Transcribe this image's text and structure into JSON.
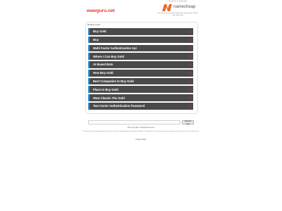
{
  "site": {
    "name": "wawguru.net"
  },
  "sponsor": {
    "note": "This domain is registered at",
    "logo_text": "namecheap",
    "description": "This domain was recently registered at Namecheap. Please check back later!"
  },
  "colors": {
    "accent": "#e8352e",
    "logo_orange": "#f26522",
    "item_bg": "#4a4a4a",
    "item_bar": "#2f8fd1"
  },
  "related": {
    "title": "Related Links",
    "links": [
      {
        "label": "Buy Gold"
      },
      {
        "label": "Buy"
      },
      {
        "label": "Multi Factor Authentication Api"
      },
      {
        "label": "Where I Can Buy Gold"
      },
      {
        "label": "AI Based Bots"
      },
      {
        "label": "How Buy Gold"
      },
      {
        "label": "Best Companies to Buy Gold"
      },
      {
        "label": "Place to Buy Gold"
      },
      {
        "label": "Wow Classic Tbc Gold"
      },
      {
        "label": "Two Factor Authentication Password"
      }
    ],
    "arrow_icon": "chevron-right-icon"
  },
  "search": {
    "value": "",
    "placeholder": "",
    "button_label": "Search Ads"
  },
  "footer": {
    "copyright": "2024 Copyright. All Rights Reserved.",
    "disclaimer": "The Sponsored Listings displayed above are served automatically by a third party. Neither Parkingcrew nor the domain owner maintain any relationship with the advertisers.",
    "privacy_label": "Privacy Policy"
  }
}
